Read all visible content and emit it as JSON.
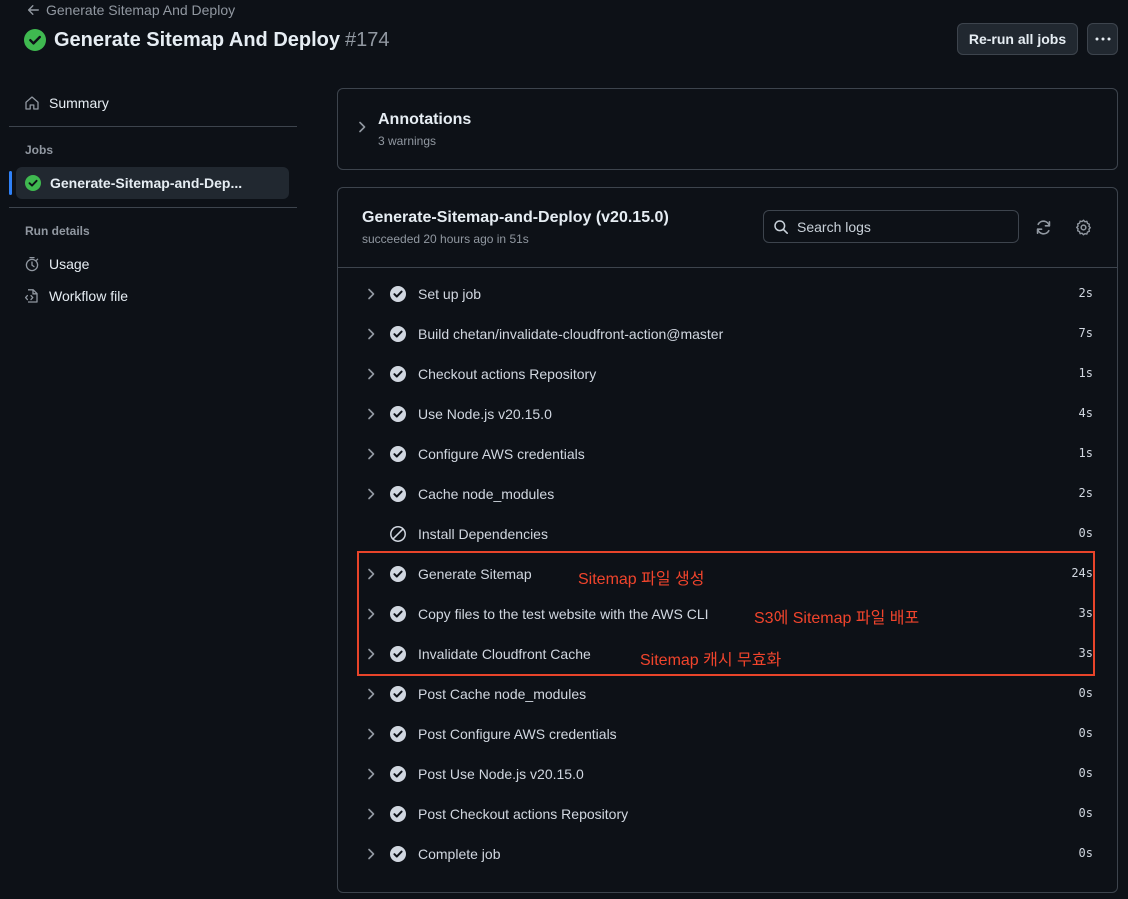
{
  "header": {
    "back_label": "Generate Sitemap And Deploy",
    "title": "Generate Sitemap And Deploy",
    "run_number": "#174",
    "rerun_label": "Re-run all jobs",
    "more_label": "···"
  },
  "sidebar": {
    "summary_label": "Summary",
    "jobs_heading": "Jobs",
    "active_job": "Generate-Sitemap-and-Dep...",
    "run_details_heading": "Run details",
    "usage_label": "Usage",
    "workflow_file_label": "Workflow file"
  },
  "annotations": {
    "title": "Annotations",
    "subtitle": "3 warnings"
  },
  "job": {
    "title": "Generate-Sitemap-and-Deploy (v20.15.0)",
    "subtitle": "succeeded 20 hours ago in 51s",
    "search_placeholder": "Search logs",
    "steps": [
      {
        "name": "Set up job",
        "duration": "2s",
        "status": "success"
      },
      {
        "name": "Build chetan/invalidate-cloudfront-action@master",
        "duration": "7s",
        "status": "success"
      },
      {
        "name": "Checkout actions Repository",
        "duration": "1s",
        "status": "success"
      },
      {
        "name": "Use Node.js v20.15.0",
        "duration": "4s",
        "status": "success"
      },
      {
        "name": "Configure AWS credentials",
        "duration": "1s",
        "status": "success"
      },
      {
        "name": "Cache node_modules",
        "duration": "2s",
        "status": "success"
      },
      {
        "name": "Install Dependencies",
        "duration": "0s",
        "status": "skipped"
      },
      {
        "name": "Generate Sitemap",
        "duration": "24s",
        "status": "success"
      },
      {
        "name": "Copy files to the test website with the AWS CLI",
        "duration": "3s",
        "status": "success"
      },
      {
        "name": "Invalidate Cloudfront Cache",
        "duration": "3s",
        "status": "success"
      },
      {
        "name": "Post Cache node_modules",
        "duration": "0s",
        "status": "success"
      },
      {
        "name": "Post Configure AWS credentials",
        "duration": "0s",
        "status": "success"
      },
      {
        "name": "Post Use Node.js v20.15.0",
        "duration": "0s",
        "status": "success"
      },
      {
        "name": "Post Checkout actions Repository",
        "duration": "0s",
        "status": "success"
      },
      {
        "name": "Complete job",
        "duration": "0s",
        "status": "success"
      }
    ]
  },
  "overlay_notes": {
    "note1": "Sitemap 파일 생성",
    "note2": "S3에 Sitemap 파일 배포",
    "note3": "Sitemap 캐시 무효화"
  },
  "colors": {
    "success": "#3fb950",
    "accent": "#2f81f7",
    "annotation_red": "#e8442a"
  }
}
